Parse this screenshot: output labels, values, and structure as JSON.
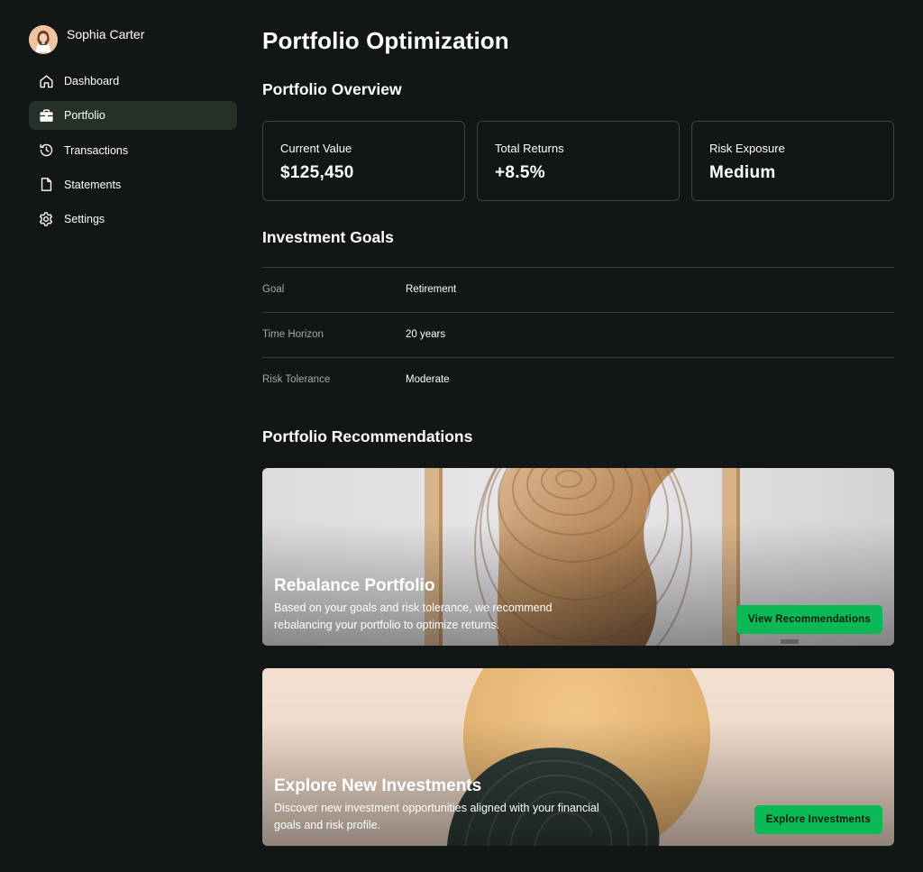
{
  "user": {
    "name": "Sophia Carter"
  },
  "nav": {
    "items": [
      {
        "label": "Dashboard",
        "icon": "home-icon",
        "active": false
      },
      {
        "label": "Portfolio",
        "icon": "briefcase-icon",
        "active": true
      },
      {
        "label": "Transactions",
        "icon": "history-icon",
        "active": false
      },
      {
        "label": "Statements",
        "icon": "document-icon",
        "active": false
      },
      {
        "label": "Settings",
        "icon": "gear-icon",
        "active": false
      }
    ]
  },
  "page": {
    "title": "Portfolio Optimization"
  },
  "overview": {
    "title": "Portfolio Overview",
    "cards": [
      {
        "label": "Current Value",
        "value": "$125,450"
      },
      {
        "label": "Total Returns",
        "value": "+8.5%"
      },
      {
        "label": "Risk Exposure",
        "value": "Medium"
      }
    ]
  },
  "goals": {
    "title": "Investment Goals",
    "rows": [
      {
        "key": "Goal",
        "value": "Retirement"
      },
      {
        "key": "Time Horizon",
        "value": "20 years"
      },
      {
        "key": "Risk Tolerance",
        "value": "Moderate"
      }
    ]
  },
  "recommendations": {
    "title": "Portfolio Recommendations",
    "items": [
      {
        "title": "Rebalance Portfolio",
        "description": "Based on your goals and risk tolerance, we recommend rebalancing your portfolio to optimize returns.",
        "button": "View Recommendations"
      },
      {
        "title": "Explore New Investments",
        "description": "Discover new investment opportunities aligned with your financial goals and risk profile.",
        "button": "Explore Investments"
      }
    ]
  },
  "colors": {
    "background": "#121616",
    "active_nav": "#253029",
    "accent": "#0bb956",
    "border": "#3d4442"
  }
}
